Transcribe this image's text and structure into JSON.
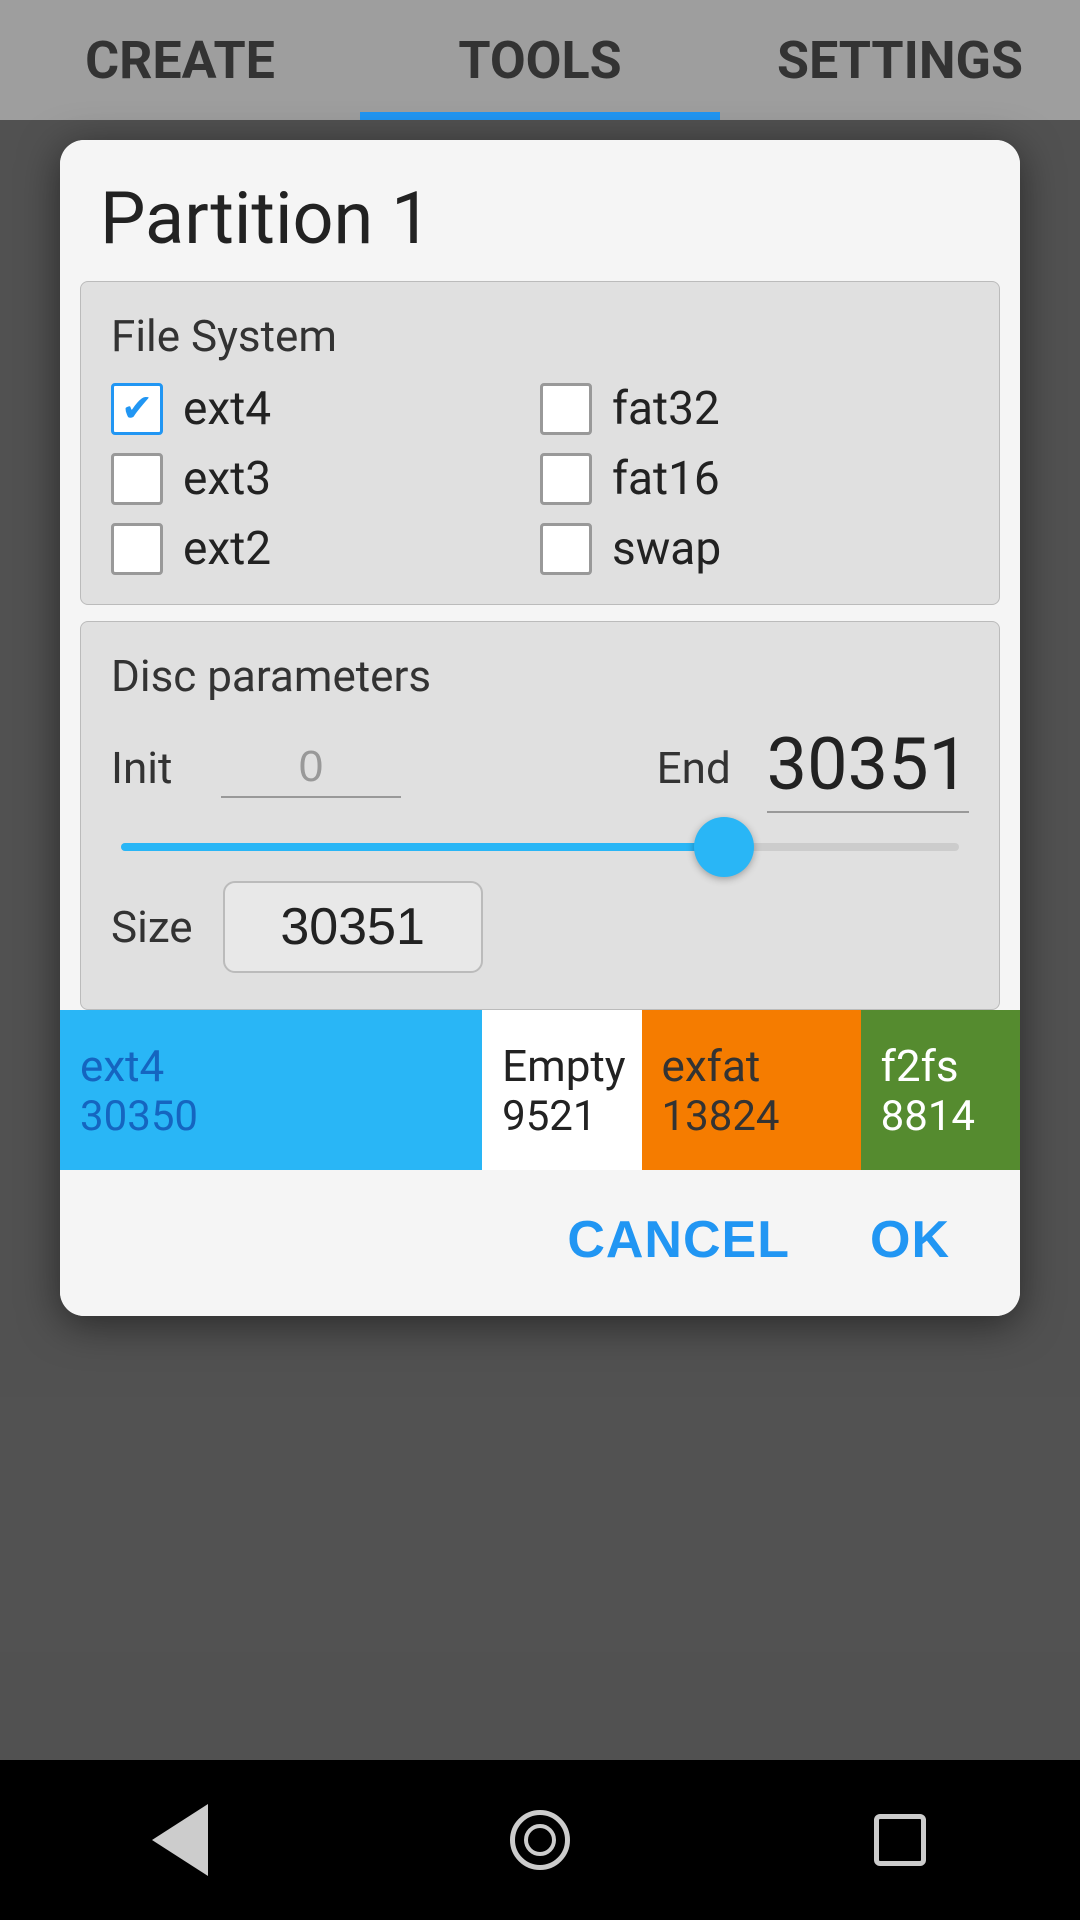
{
  "tabs": [
    {
      "id": "create",
      "label": "CREATE",
      "active": false
    },
    {
      "id": "tools",
      "label": "TOOLS",
      "active": true
    },
    {
      "id": "settings",
      "label": "SETTINGS",
      "active": false
    }
  ],
  "modal": {
    "title": "Partition  1",
    "file_system": {
      "label": "File System",
      "options": [
        {
          "id": "ext4",
          "label": "ext4",
          "checked": true,
          "col": 1
        },
        {
          "id": "ext3",
          "label": "ext3",
          "checked": false,
          "col": 1
        },
        {
          "id": "ext2",
          "label": "ext2",
          "checked": false,
          "col": 1
        },
        {
          "id": "fat32",
          "label": "fat32",
          "checked": false,
          "col": 2
        },
        {
          "id": "fat16",
          "label": "fat16",
          "checked": false,
          "col": 2
        },
        {
          "id": "swap",
          "label": "swap",
          "checked": false,
          "col": 2
        }
      ]
    },
    "disc_parameters": {
      "label": "Disc parameters",
      "init_label": "Init",
      "init_value": "0",
      "end_label": "End",
      "end_value": "30351",
      "slider_percent": 72,
      "size_label": "Size",
      "size_value": "30351"
    },
    "partition_segments": [
      {
        "name": "ext4",
        "size": "30350",
        "bg_color": "#29B6F6",
        "text_color": "#1565C0",
        "flex": 3.2
      },
      {
        "name": "Empty",
        "size": "9521",
        "bg_color": "#ffffff",
        "text_color": "#222",
        "flex": 1
      },
      {
        "name": "exfat",
        "size": "13824",
        "bg_color": "#F57C00",
        "text_color": "#333",
        "flex": 1.5
      },
      {
        "name": "f2fs",
        "size": "8814",
        "bg_color": "#558B2F",
        "text_color": "#fff",
        "flex": 1
      }
    ],
    "actions": {
      "cancel_label": "CANCEL",
      "ok_label": "OK"
    }
  },
  "bottom_nav": {
    "back_title": "Back",
    "home_title": "Home",
    "recents_title": "Recents"
  }
}
